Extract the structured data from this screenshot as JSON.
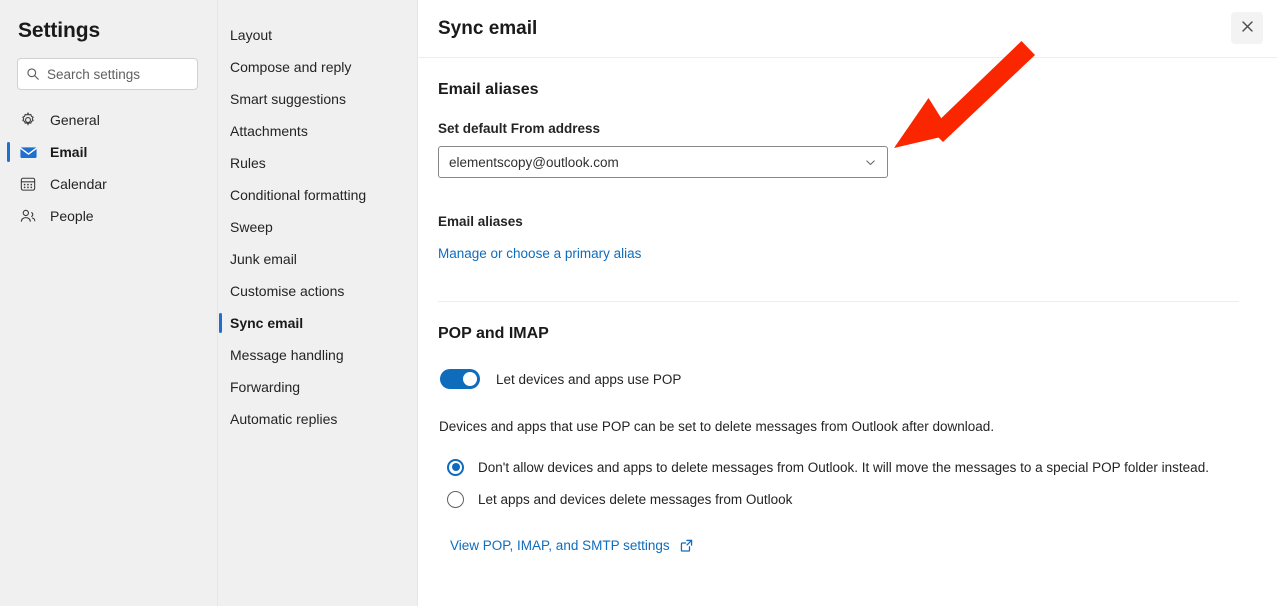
{
  "sidebar": {
    "title": "Settings",
    "search": {
      "placeholder": "Search settings",
      "value": "",
      "icon": "search-icon"
    },
    "items": [
      {
        "label": "General",
        "icon": "gear-icon",
        "active": false
      },
      {
        "label": "Email",
        "icon": "envelope-icon",
        "active": true
      },
      {
        "label": "Calendar",
        "icon": "calendar-icon",
        "active": false
      },
      {
        "label": "People",
        "icon": "people-icon",
        "active": false
      }
    ]
  },
  "subnav": {
    "items": [
      {
        "label": "Layout",
        "active": false
      },
      {
        "label": "Compose and reply",
        "active": false
      },
      {
        "label": "Smart suggestions",
        "active": false
      },
      {
        "label": "Attachments",
        "active": false
      },
      {
        "label": "Rules",
        "active": false
      },
      {
        "label": "Conditional formatting",
        "active": false
      },
      {
        "label": "Sweep",
        "active": false
      },
      {
        "label": "Junk email",
        "active": false
      },
      {
        "label": "Customise actions",
        "active": false
      },
      {
        "label": "Sync email",
        "active": true
      },
      {
        "label": "Message handling",
        "active": false
      },
      {
        "label": "Forwarding",
        "active": false
      },
      {
        "label": "Automatic replies",
        "active": false
      }
    ]
  },
  "main": {
    "title": "Sync email",
    "close_icon": "close-icon",
    "aliases": {
      "heading": "Email aliases",
      "from_label": "Set default From address",
      "from_value": "elementscopy@outlook.com",
      "chevron_icon": "chevron-down-icon",
      "sub_label": "Email aliases",
      "manage_link": "Manage or choose a primary alias"
    },
    "pop": {
      "heading": "POP and IMAP",
      "toggle_label": "Let devices and apps use POP",
      "toggle_on": true,
      "help_text": "Devices and apps that use POP can be set to delete messages from Outlook after download.",
      "options": [
        {
          "label": "Don't allow devices and apps to delete messages from Outlook. It will move the messages to a special POP folder instead.",
          "checked": true
        },
        {
          "label": "Let apps and devices delete messages from Outlook",
          "checked": false
        }
      ],
      "settings_link": "View POP, IMAP, and SMTP settings",
      "settings_link_icon": "open-in-new-icon"
    }
  },
  "annotation": {
    "type": "arrow",
    "color": "#fa2600",
    "points_to": "from-address-dropdown"
  },
  "colors": {
    "accent": "#0f6cbd",
    "active_bar": "#1f6fd0",
    "link": "#0f6cbd",
    "annotation": "#fa2600",
    "panel_bg": "#f0f0f0",
    "main_bg": "#ffffff"
  }
}
